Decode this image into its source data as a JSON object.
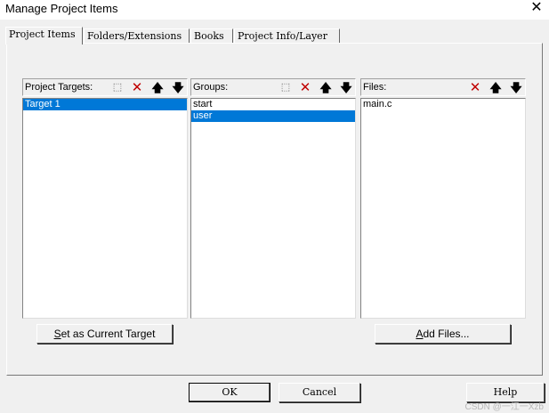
{
  "window": {
    "title": "Manage Project Items"
  },
  "tabs": [
    {
      "label": "Project Items",
      "active": true
    },
    {
      "label": "Folders/Extensions",
      "active": false
    },
    {
      "label": "Books",
      "active": false
    },
    {
      "label": "Project Info/Layer",
      "active": false
    }
  ],
  "targets": {
    "label": "Project Targets:",
    "items": [
      {
        "text": "Target 1",
        "selected": true
      }
    ],
    "button_prefix": "S",
    "button_rest": "et as Current Target"
  },
  "groups": {
    "label": "Groups:",
    "items": [
      {
        "text": "start",
        "selected": false
      },
      {
        "text": "user",
        "selected": true
      }
    ]
  },
  "files": {
    "label": "Files:",
    "items": [
      {
        "text": "main.c",
        "selected": false
      }
    ],
    "button_prefix": "A",
    "button_rest": "dd Files..."
  },
  "footer": {
    "ok": "OK",
    "cancel": "Cancel",
    "help": "Help"
  },
  "watermark": "CSDN @一江一Xzb"
}
